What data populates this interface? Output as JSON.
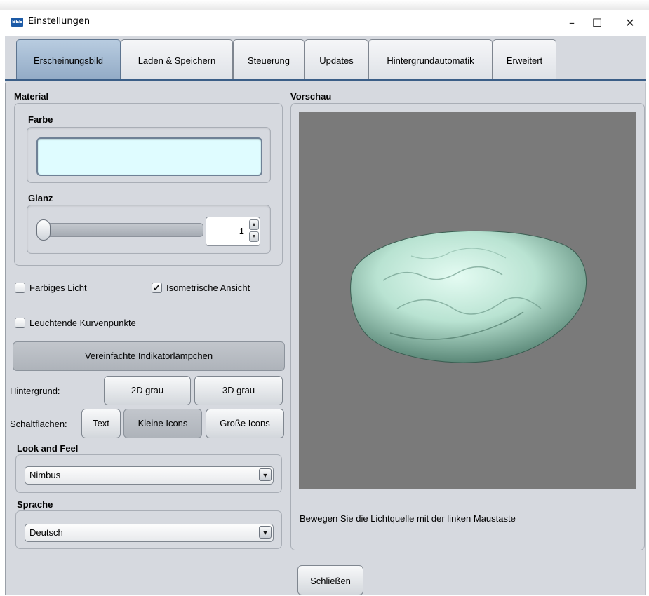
{
  "window": {
    "title": "Einstellungen",
    "app_icon_text": "BEE",
    "minimize": "–",
    "maximize": "☐",
    "close": "✕"
  },
  "tabs": [
    {
      "label": "Erscheinungsbild",
      "selected": true
    },
    {
      "label": "Laden & Speichern",
      "selected": false
    },
    {
      "label": "Steuerung",
      "selected": false
    },
    {
      "label": "Updates",
      "selected": false
    },
    {
      "label": "Hintergrundautomatik",
      "selected": false
    },
    {
      "label": "Erweitert",
      "selected": false
    }
  ],
  "material": {
    "title": "Material",
    "farbe_label": "Farbe",
    "farbe_color": "#dffcff",
    "glanz_label": "Glanz",
    "glanz_slider_fraction": 0.0,
    "glanz_value": "1"
  },
  "checks": {
    "farbiges_licht": {
      "label": "Farbiges Licht",
      "checked": false
    },
    "isometrische": {
      "label": "Isometrische Ansicht",
      "checked": true,
      "mark": "✓"
    },
    "leuchtende": {
      "label": "Leuchtende Kurvenpunkte",
      "checked": false
    }
  },
  "indicator_button": "Vereinfachte Indikatorlämpchen",
  "hintergrund": {
    "label": "Hintergrund:",
    "btn_2d": "2D grau",
    "btn_3d": "3D grau"
  },
  "schaltflaechen": {
    "label": "Schaltflächen:",
    "btn_text": "Text",
    "btn_kleine": "Kleine Icons",
    "btn_grosse": "Große Icons"
  },
  "laf": {
    "title": "Look and Feel",
    "value": "Nimbus",
    "arrow": "▼"
  },
  "sprache": {
    "title": "Sprache",
    "value": "Deutsch",
    "arrow": "▼"
  },
  "vorschau": {
    "title": "Vorschau",
    "hint": "Bewegen Sie die Lichtquelle mit der linken Maustaste",
    "background_color": "#7a7a7a",
    "object_color": "#b9e3d2"
  },
  "close_button": "Schließen"
}
